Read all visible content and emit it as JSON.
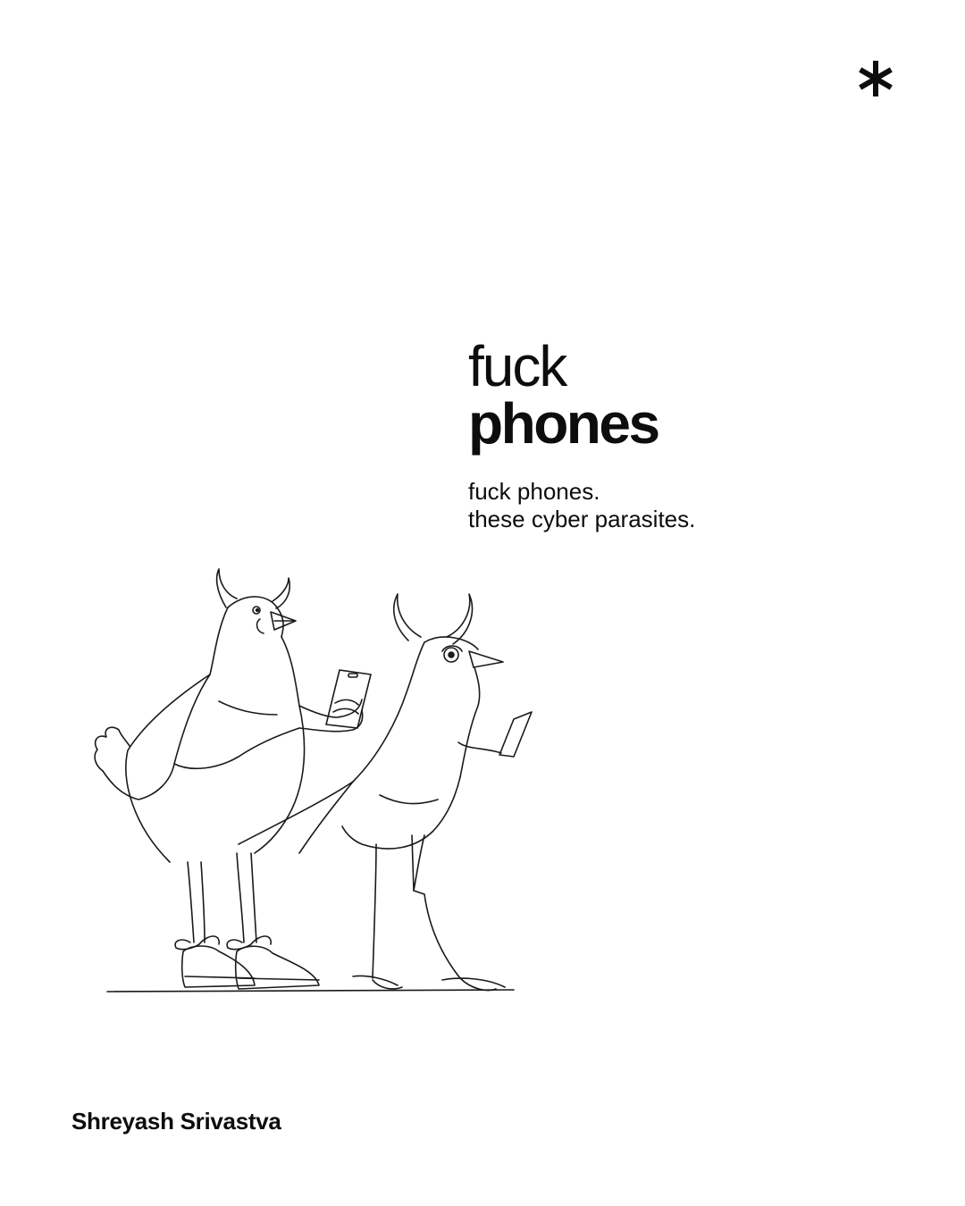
{
  "corner_icon": "asterisk-icon",
  "title": {
    "line1": "fuck",
    "line2": "phones"
  },
  "subtitle": {
    "line1": "fuck phones.",
    "line2": "these cyber parasites."
  },
  "illustration": "two-horned-birds-with-phones-illustration",
  "author": "Shreyash Srivastva",
  "colors": {
    "background": "#ffffff",
    "text": "#0d0d0d"
  }
}
